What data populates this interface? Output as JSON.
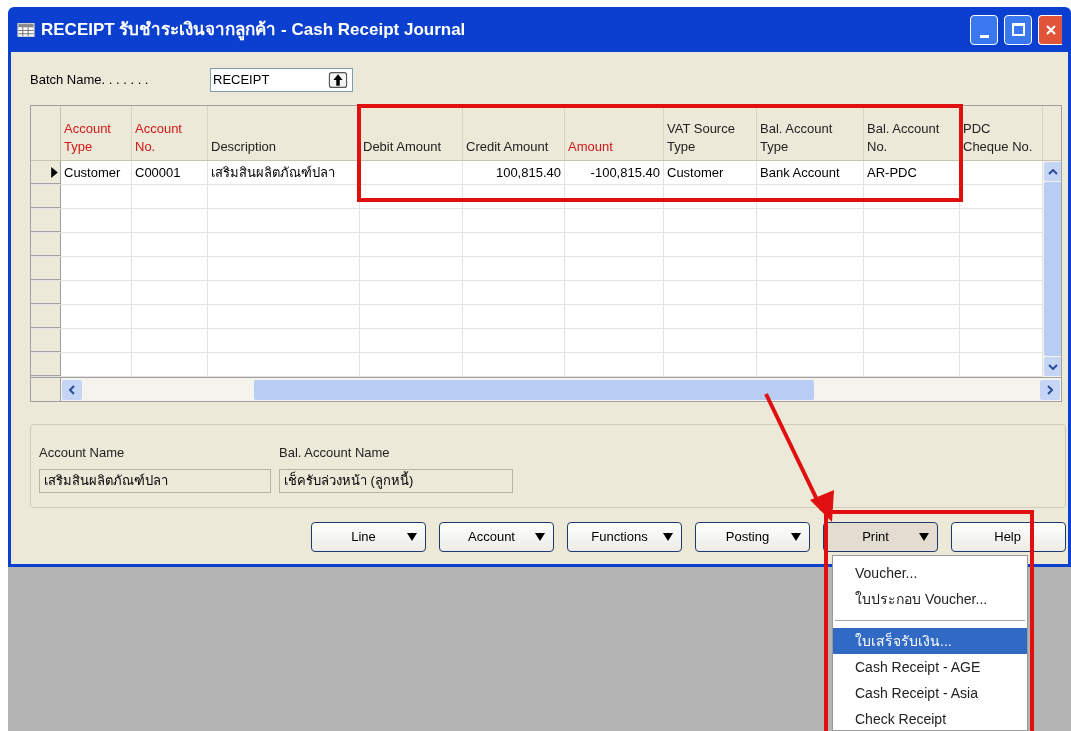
{
  "window": {
    "title": "RECEIPT รับชำระเงินจากลูกค้า - Cash Receipt Journal"
  },
  "batch": {
    "label": "Batch Name. . . . . . .",
    "value": "RECEIPT"
  },
  "table": {
    "columns": [
      {
        "label": "Account\nType",
        "required": true
      },
      {
        "label": "Account\nNo.",
        "required": true
      },
      {
        "label": "Description",
        "required": false
      },
      {
        "label": "Debit Amount",
        "required": false
      },
      {
        "label": "Credit Amount",
        "required": false
      },
      {
        "label": "Amount",
        "required": true
      },
      {
        "label": "VAT Source\nType",
        "required": false
      },
      {
        "label": "Bal. Account\nType",
        "required": false
      },
      {
        "label": "Bal. Account\nNo.",
        "required": false
      },
      {
        "label": "PDC\nCheque No.",
        "required": false
      }
    ],
    "rows": [
      {
        "current": true,
        "cells": [
          "Customer",
          "C00001",
          "เสริมสินผลิตภัณฑ์ปลา",
          "",
          "100,815.40",
          "-100,815.40",
          "Customer",
          "Bank Account",
          "AR-PDC",
          ""
        ]
      },
      {
        "current": false,
        "cells": [
          "",
          "",
          "",
          "",
          "",
          "",
          "",
          "",
          "",
          ""
        ]
      },
      {
        "current": false,
        "cells": [
          "",
          "",
          "",
          "",
          "",
          "",
          "",
          "",
          "",
          ""
        ]
      },
      {
        "current": false,
        "cells": [
          "",
          "",
          "",
          "",
          "",
          "",
          "",
          "",
          "",
          ""
        ]
      },
      {
        "current": false,
        "cells": [
          "",
          "",
          "",
          "",
          "",
          "",
          "",
          "",
          "",
          ""
        ]
      },
      {
        "current": false,
        "cells": [
          "",
          "",
          "",
          "",
          "",
          "",
          "",
          "",
          "",
          ""
        ]
      },
      {
        "current": false,
        "cells": [
          "",
          "",
          "",
          "",
          "",
          "",
          "",
          "",
          "",
          ""
        ]
      },
      {
        "current": false,
        "cells": [
          "",
          "",
          "",
          "",
          "",
          "",
          "",
          "",
          "",
          ""
        ]
      },
      {
        "current": false,
        "cells": [
          "",
          "",
          "",
          "",
          "",
          "",
          "",
          "",
          "",
          ""
        ]
      }
    ]
  },
  "info": [
    {
      "label": "Account Name",
      "value": "เสริมสินผลิตภัณฑ์ปลา"
    },
    {
      "label": "Bal. Account Name",
      "value": "เช็ครับล่วงหน้า (ลูกหนี้)"
    }
  ],
  "buttons": [
    {
      "label": "Line",
      "dropdown": true,
      "pressed": false
    },
    {
      "label": "Account",
      "dropdown": true,
      "pressed": false
    },
    {
      "label": "Functions",
      "dropdown": true,
      "pressed": false
    },
    {
      "label": "Posting",
      "dropdown": true,
      "pressed": false
    },
    {
      "label": "Print",
      "dropdown": true,
      "pressed": true
    },
    {
      "label": "Help",
      "dropdown": false,
      "pressed": false
    }
  ],
  "print_menu": [
    {
      "kind": "item",
      "label": "Voucher...",
      "selected": false
    },
    {
      "kind": "item",
      "label": "ใบประกอบ Voucher...",
      "selected": false
    },
    {
      "kind": "separator"
    },
    {
      "kind": "item",
      "label": "ใบเสร็จรับเงิน...",
      "selected": true
    },
    {
      "kind": "item",
      "label": "Cash Receipt - AGE",
      "selected": false
    },
    {
      "kind": "item",
      "label": "Cash Receipt - Asia",
      "selected": false
    },
    {
      "kind": "item",
      "label": "Check Receipt",
      "selected": false
    }
  ]
}
